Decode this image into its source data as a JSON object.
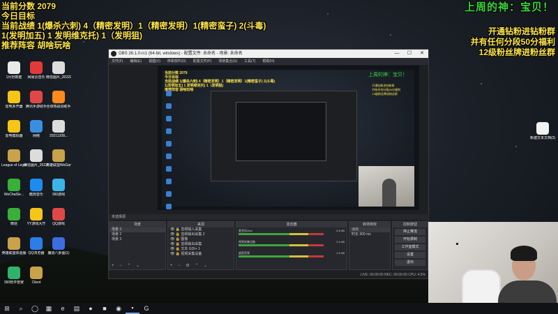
{
  "overlay": {
    "left_lines": [
      "当前分数 2079",
      "今日目标",
      "当前战绩 1(爆杀六刺) 4（精密发明）1（精密发明）1(精密蛮子) 2(斗毒)",
      "1(发明加五) 1 发明维克托) 1（发明狙)",
      "推荐阵容 胡啥玩啥"
    ],
    "god_text": "上周的神：宝贝！",
    "right_lines": [
      "开通钻粉进钻粉群",
      "并有任何分段50分福利",
      "12级粉丝牌进粉丝群"
    ]
  },
  "desktop_icons": [
    {
      "label": "1月份数据",
      "color": "#e9e9e9"
    },
    {
      "label": "网易云音乐",
      "color": "#e23a3a"
    },
    {
      "label": "微信图片_2022021...",
      "color": "#dcdcdc"
    },
    {
      "label": "雷电多开器",
      "color": "#f5c518"
    },
    {
      "label": "腾讯手游助手",
      "color": "#e04848"
    },
    {
      "label": "全球热战洞助手",
      "color": "#ff8a1c"
    },
    {
      "label": "雷电模拟器",
      "color": "#f5c518"
    },
    {
      "label": "网络",
      "color": "#3a8ee0"
    },
    {
      "label": "20211208...",
      "color": "#dcdcdc"
    },
    {
      "label": "League of Legends",
      "color": "#c9a24a"
    },
    {
      "label": "微信图片_2022021...",
      "color": "#dcdcdc"
    },
    {
      "label": "英雄联盟WeGame版",
      "color": "#c9a24a"
    },
    {
      "label": "WeChatSe...",
      "color": "#38b03a"
    },
    {
      "label": "酷狗音乐",
      "color": "#1d8cf0"
    },
    {
      "label": "360游戏",
      "color": "#3bb5e8"
    },
    {
      "label": "微信",
      "color": "#38b03a"
    },
    {
      "label": "YY游戏大厅",
      "color": "#f5c518"
    },
    {
      "label": "QQ游戏",
      "color": "#e04848"
    },
    {
      "label": "英雄联盟体验服",
      "color": "#c9a24a"
    },
    {
      "label": "QQ浏览器",
      "color": "#2b7de9"
    },
    {
      "label": "魔道八卦图(1)",
      "color": "#3b6ee0"
    },
    {
      "label": "360软件管家",
      "color": "#2fb36a"
    },
    {
      "label": "Client",
      "color": "#c9a24a"
    }
  ],
  "desktop_right_icon": "新建文本文档(3)",
  "obs": {
    "title": "OBS 26.1.0-rc1 (64-bit, windows) - 配置文件: 未命名 - 场景: 未命名",
    "menu": [
      "文件(F)",
      "编辑(E)",
      "视图(V)",
      "停靠部件(D)",
      "配置文件(P)",
      "场景集合(S)",
      "工具(T)",
      "帮助(H)"
    ],
    "status": "未选择源",
    "scenes_title": "场景",
    "scenes": [
      "场景 2",
      "场景 2",
      "场景 3"
    ],
    "sources_title": "来源",
    "sources": [
      "音频输入采集",
      "音频输出采集 2",
      "图像",
      "音频输出采集",
      "文本 GDI+ 1",
      "视频采集设备"
    ],
    "mixer_title": "混音器",
    "mixer": [
      {
        "name": "麦克风/Aux",
        "db": "-5.5 dB"
      },
      {
        "name": "视频采集设备",
        "db": "0.0 dB"
      },
      {
        "name": "桌面音频",
        "db": "0.0 dB"
      }
    ],
    "transitions_title": "转场特效",
    "transition": "淡出",
    "duration_label": "时长",
    "duration": "300 ms",
    "controls_title": "控制按钮",
    "controls": [
      "停止推流",
      "开始录制",
      "工作室模式",
      "设置",
      "退出"
    ],
    "footer": "LIVE: 00:00:00   REC: 00:00:00   CPU: 4.5%"
  },
  "taskbar": [
    "⊞",
    "⌕",
    "◯",
    "▦",
    "e",
    "▤",
    "●",
    "■",
    "◉",
    "▪",
    "G"
  ]
}
